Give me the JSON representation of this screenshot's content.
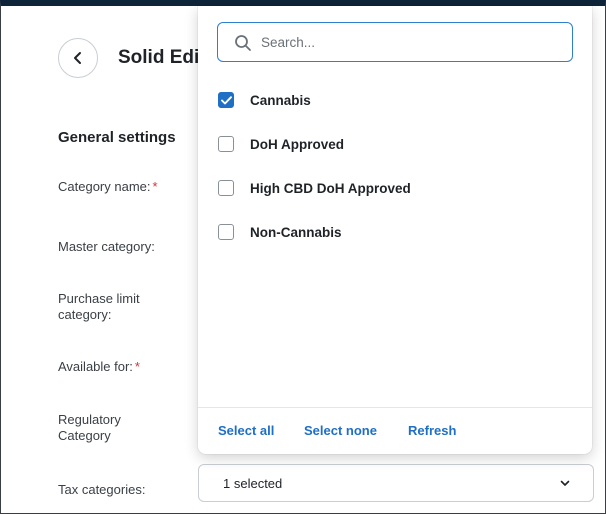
{
  "header": {
    "title": "Solid Edi"
  },
  "form": {
    "section_title": "General settings",
    "labels": {
      "category_name": "Category name:",
      "master_category": "Master category:",
      "purchase_limit_line1": "Purchase limit",
      "purchase_limit_line2": "category:",
      "available_for": "Available for:",
      "regulatory_line1": "Regulatory",
      "regulatory_line2": "Category",
      "tax_categories": "Tax categories:"
    },
    "required_mark": "*",
    "tax_select": {
      "value": "1 selected"
    }
  },
  "dropdown": {
    "search_placeholder": "Search...",
    "search_value": "",
    "options": [
      {
        "label": "Cannabis",
        "checked": true
      },
      {
        "label": "DoH Approved",
        "checked": false
      },
      {
        "label": "High CBD DoH Approved",
        "checked": false
      },
      {
        "label": "Non-Cannabis",
        "checked": false
      }
    ],
    "footer": {
      "select_all": "Select all",
      "select_none": "Select none",
      "refresh": "Refresh"
    }
  },
  "colors": {
    "accent": "#1f6fc5",
    "required": "#d0323a",
    "top_bar": "#0e2438"
  },
  "icons": {
    "back": "chevron-left-icon",
    "search": "search-icon",
    "checkmark": "checkmark-icon",
    "dropdown_arrow": "chevron-down-icon"
  }
}
